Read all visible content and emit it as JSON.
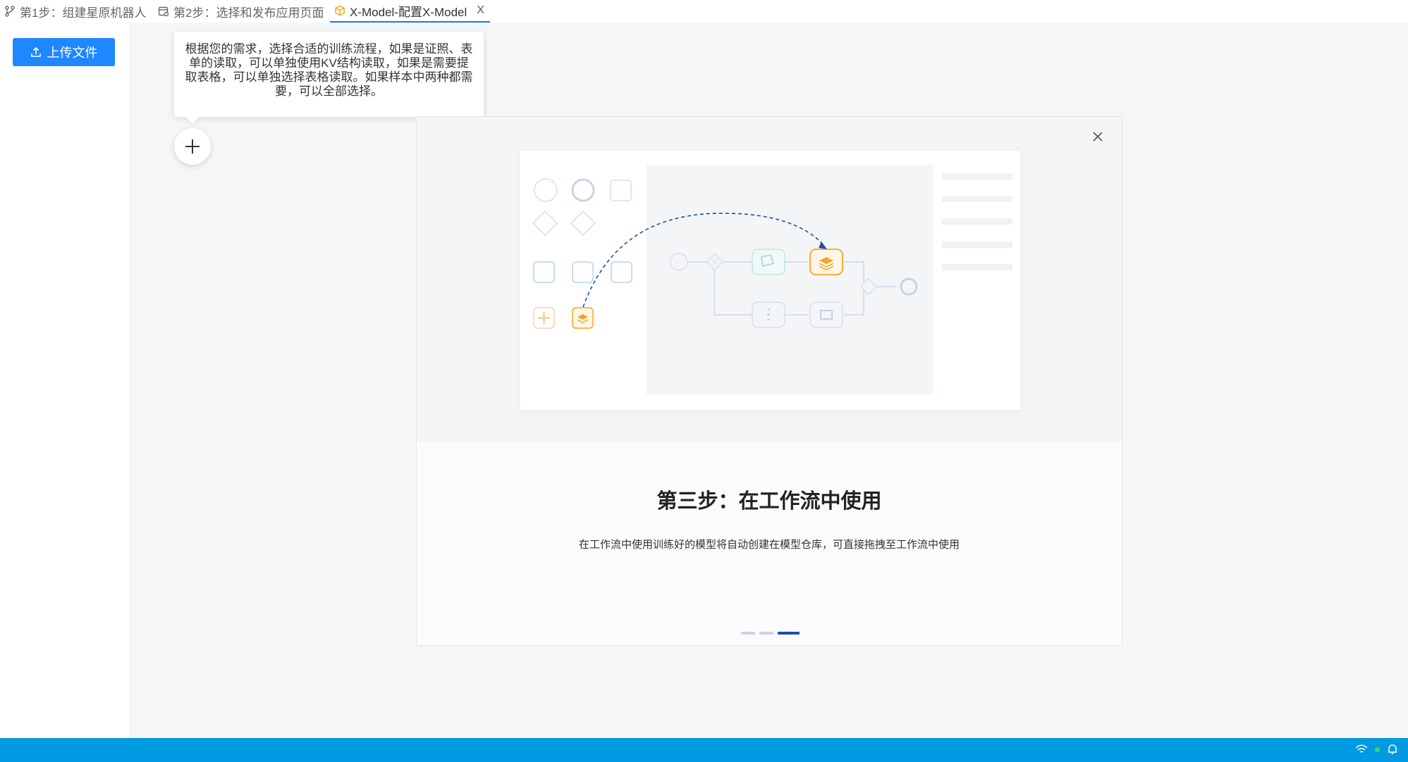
{
  "tabs": [
    {
      "label": "第1步：组建星原机器人",
      "icon": "flow-icon"
    },
    {
      "label": "第2步：选择和发布应用页面",
      "icon": "app-page-icon"
    },
    {
      "label": "X-Model-配置X-Model",
      "icon": "cube-icon",
      "close": "X"
    }
  ],
  "sidebar": {
    "upload_label": "上传文件",
    "upload_icon": "upload-icon"
  },
  "tooltip": {
    "text": "根据您的需求，选择合适的训练流程，如果是证照、表单的读取，可以单独使用KV结构读取，如果是需要提取表格，可以单独选择表格读取。如果样本中两种都需要，可以全部选择。"
  },
  "guide": {
    "title": "第三步：在工作流中使用",
    "description": "在工作流中使用训练好的模型将自动创建在模型仓库，可直接拖拽至工作流中使用",
    "steps_total": 3,
    "current_step": 3
  },
  "colors": {
    "accent": "#1f87ff",
    "statusbar": "#009ae3",
    "highlight": "#f5a623",
    "tab_underline": "#1677ff"
  },
  "statusbar": {
    "icons": [
      "wifi-icon",
      "status-dot-icon",
      "bell-icon"
    ]
  }
}
